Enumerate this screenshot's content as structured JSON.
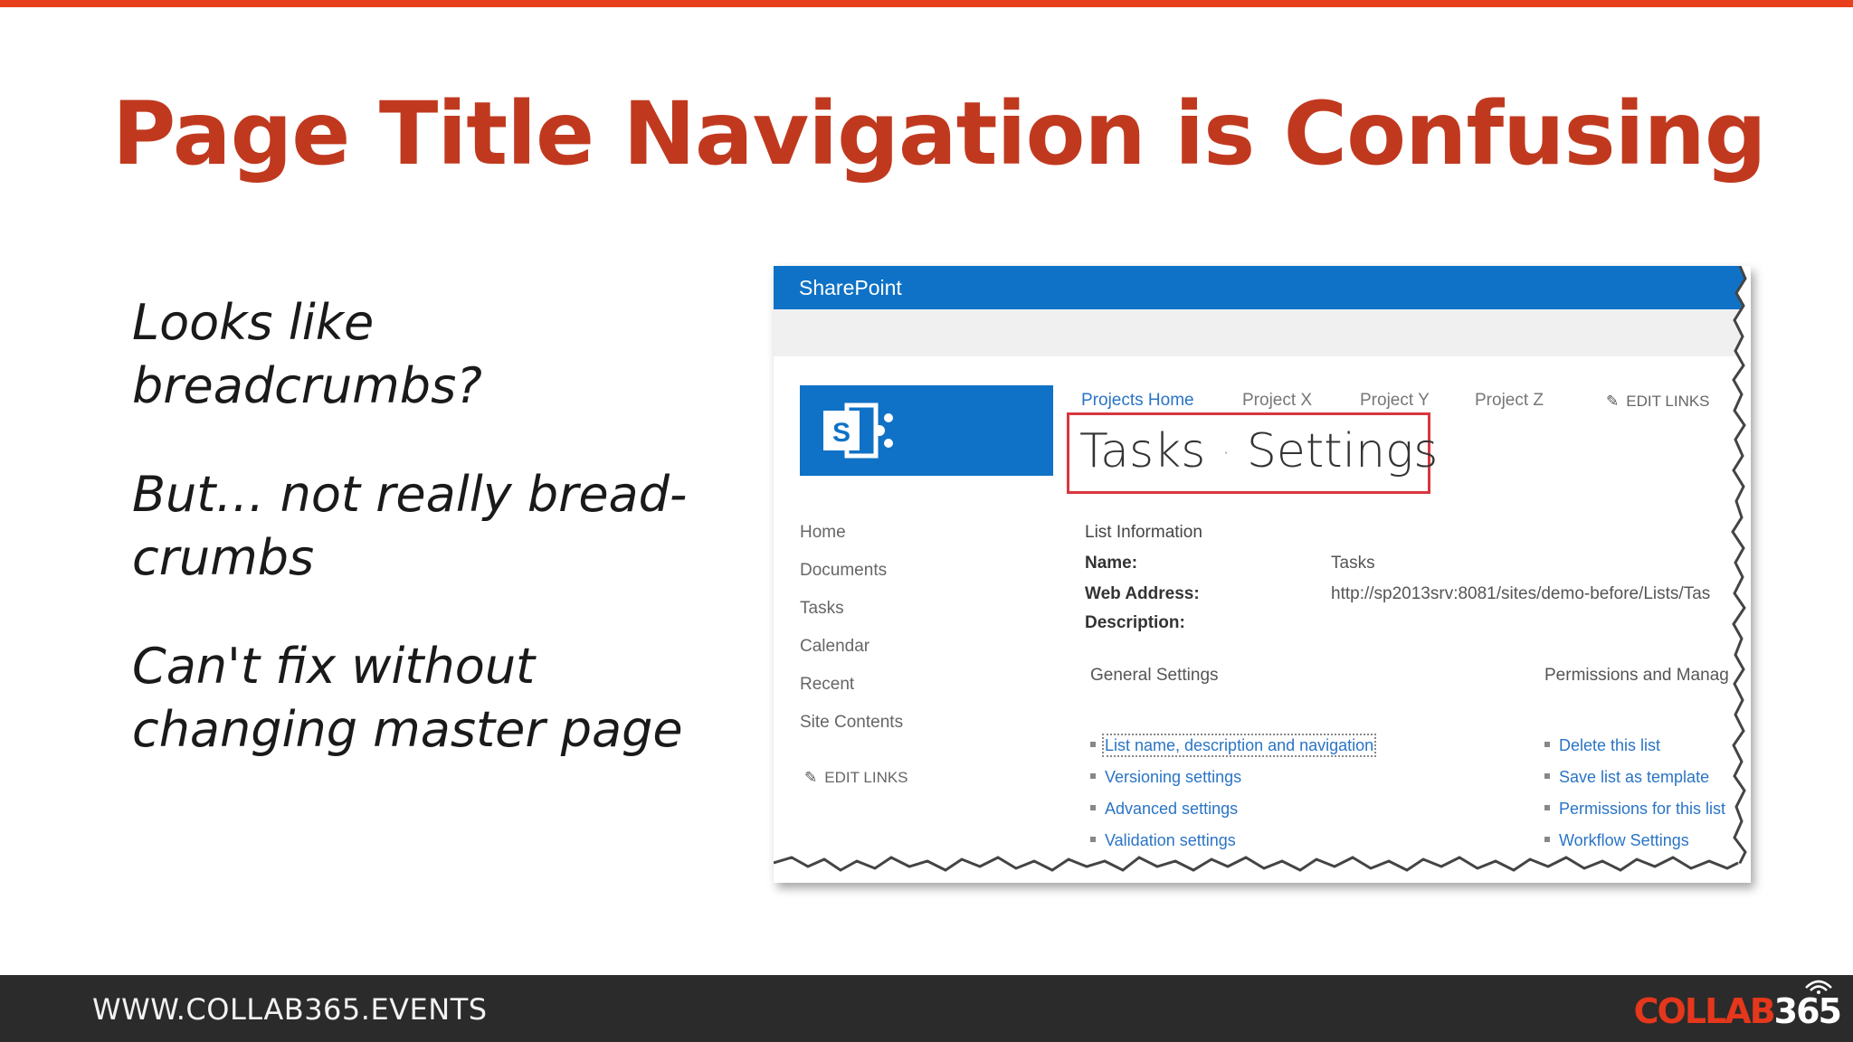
{
  "slide": {
    "title": "Page Title Navigation is Confusing",
    "bullets": [
      "Looks like breadcrumbs?",
      "But… not really bread-crumbs",
      "Can't fix without changing master page"
    ]
  },
  "screenshot": {
    "brand": "SharePoint",
    "top_nav": [
      "Projects Home",
      "Project X",
      "Project Y",
      "Project Z"
    ],
    "edit_links": "EDIT LINKS",
    "heading": {
      "part1": "Tasks",
      "separator": "·",
      "part2": "Settings"
    },
    "left_nav": [
      "Home",
      "Documents",
      "Tasks",
      "Calendar",
      "Recent",
      "Site Contents"
    ],
    "list_information": {
      "label": "List Information",
      "name_label": "Name:",
      "name_value": "Tasks",
      "web_address_label": "Web Address:",
      "web_address_value": "http://sp2013srv:8081/sites/demo-before/Lists/Tas",
      "description_label": "Description:"
    },
    "general_settings": {
      "heading": "General Settings",
      "links": [
        "List name, description and navigation",
        "Versioning settings",
        "Advanced settings",
        "Validation settings"
      ]
    },
    "permissions": {
      "heading": "Permissions and Manag",
      "links": [
        "Delete this list",
        "Save list as template",
        "Permissions for this list",
        "Workflow Settings"
      ]
    }
  },
  "footer": {
    "url": "WWW.COLLAB365.EVENTS",
    "brand_part1": "COLLAB",
    "brand_part2": "365"
  },
  "colors": {
    "accent": "#e8401c",
    "title": "#c0391f",
    "sharepoint_blue": "#0f72c6",
    "link_blue": "#2a74c5",
    "highlight_box": "#d9363e",
    "footer_bg": "#2b2b2b"
  }
}
